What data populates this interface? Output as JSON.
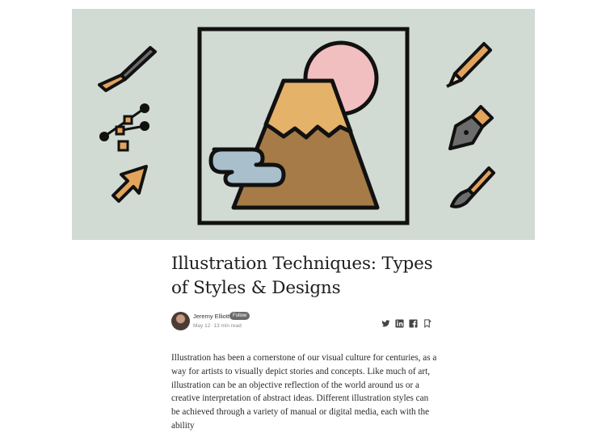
{
  "article": {
    "title": "Illustration Techniques: Types of Styles & Designs",
    "author": "Jeremy Elliott",
    "follow_label": "Follow",
    "date": "May 12",
    "read_time": "13 min read",
    "body": "Illustration has been a cornerstone of our visual culture for centuries, as a way for artists to visually depict stories and concepts. Like much of art, illustration can be an objective reflection of the world around us or a creative interpretation of abstract ideas. Different illustration styles can be achieved through a variety of manual or digital media, each with the ability"
  },
  "hero": {
    "background": "#d1dad3",
    "icons": [
      "chisel-icon",
      "vector-nodes-icon",
      "cursor-arrow-icon",
      "mountain-sun-icon",
      "pencil-icon",
      "pen-nib-icon",
      "paintbrush-icon"
    ]
  },
  "share_icons": [
    "twitter-icon",
    "linkedin-icon",
    "facebook-icon",
    "bookmark-icon"
  ]
}
